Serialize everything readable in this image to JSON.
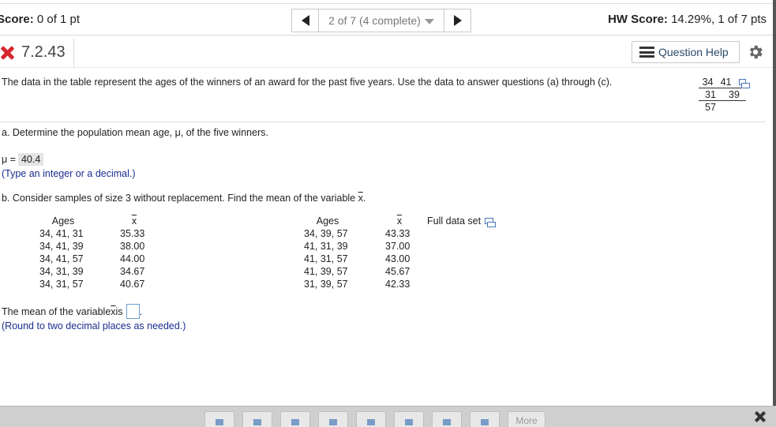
{
  "topbar": {
    "score_label": "Score:",
    "score_value": "0 of 1 pt",
    "progress": "2 of 7 (4 complete)",
    "hw_score_label": "HW Score:",
    "hw_score_value": "14.29%, 1 of 7 pts"
  },
  "question": {
    "id": "7.2.43",
    "status": "incorrect",
    "help_label": "Question Help",
    "intro": "The data in the table represent the ages of the winners of an award for the past five years. Use the data to answer questions (a) through (c).",
    "data_table": {
      "row1": [
        "34",
        "41"
      ],
      "row2": [
        "31",
        "39"
      ],
      "row3": [
        "57"
      ]
    }
  },
  "part_a": {
    "text": "a. Determine the population mean age, μ, of the five winners.",
    "mu_label": "μ =",
    "mu_value": "40.4",
    "hint": "(Type an integer or a decimal.)"
  },
  "part_b": {
    "text_prefix": "b. Consider samples of size 3 without replacement. Find the mean of the variable ",
    "text_var": "x",
    "text_suffix": ".",
    "ages_header": "Ages",
    "xbar_header": "x",
    "full_data_label": "Full data set",
    "left_ages": [
      "34, 41, 31",
      "34, 41, 39",
      "34, 41, 57",
      "34, 31, 39",
      "34, 31, 57"
    ],
    "left_means": [
      "35.33",
      "38.00",
      "44.00",
      "34.67",
      "40.67"
    ],
    "right_ages": [
      "34, 39, 57",
      "41, 31, 39",
      "41, 31, 57",
      "41, 39, 57",
      "31, 39, 57"
    ],
    "right_means": [
      "43.33",
      "37.00",
      "43.00",
      "45.67",
      "42.33"
    ],
    "mean_prefix": "The mean of the variable ",
    "mean_var": "x",
    "mean_mid": " is",
    "mean_suffix": ".",
    "mean_hint": "(Round to two decimal places as needed.)"
  },
  "toolbar": {
    "more_label": "More"
  },
  "colors": {
    "incorrect": "#d7262e",
    "hint_blue": "#1a2d8f",
    "toolbar_bg": "#cfcfcf"
  }
}
